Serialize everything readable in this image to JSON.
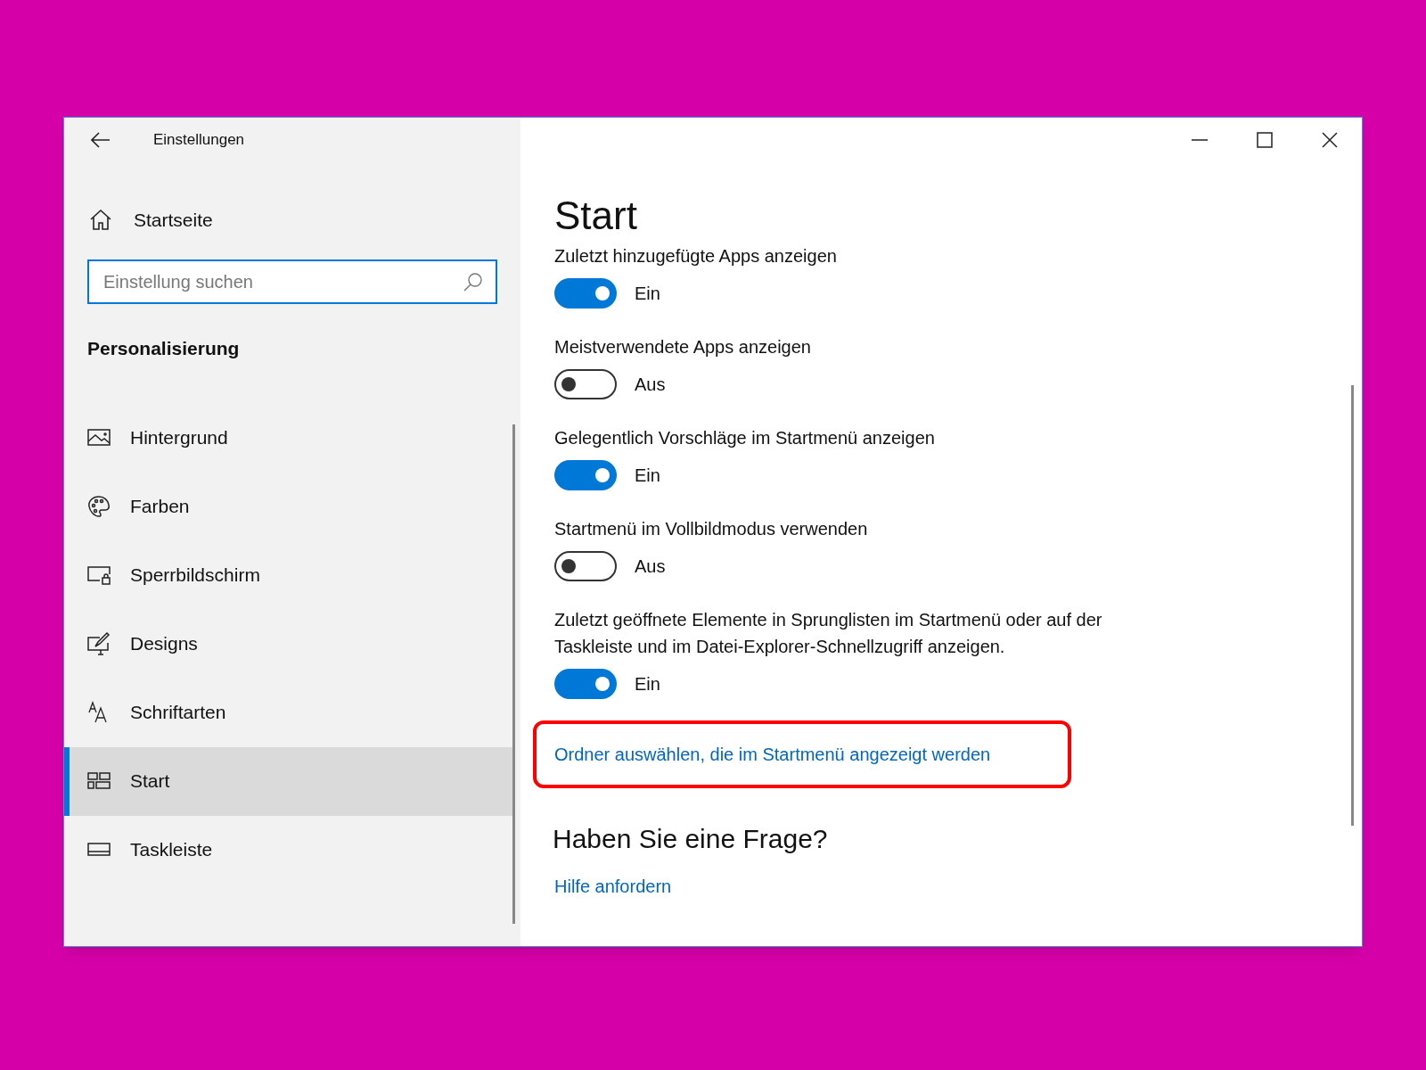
{
  "window": {
    "title": "Einstellungen"
  },
  "sidebar": {
    "home": "Startseite",
    "search": {
      "placeholder": "Einstellung suchen"
    },
    "section": "Personalisierung",
    "items": [
      {
        "kind": "picture",
        "label": "Hintergrund",
        "selected": false
      },
      {
        "kind": "palette",
        "label": "Farben",
        "selected": false
      },
      {
        "kind": "lockscreen",
        "label": "Sperrbildschirm",
        "selected": false
      },
      {
        "kind": "designs",
        "label": "Designs",
        "selected": false
      },
      {
        "kind": "fonts",
        "label": "Schriftarten",
        "selected": false
      },
      {
        "kind": "start",
        "label": "Start",
        "selected": true
      },
      {
        "kind": "taskbar",
        "label": "Taskleiste",
        "selected": false
      }
    ]
  },
  "page": {
    "title": "Start",
    "settings": [
      {
        "label": "Zuletzt hinzugefügte Apps anzeigen",
        "on": true,
        "state": "Ein"
      },
      {
        "label": "Meistverwendete Apps anzeigen",
        "on": false,
        "state": "Aus"
      },
      {
        "label": "Gelegentlich Vorschläge im Startmenü anzeigen",
        "on": true,
        "state": "Ein"
      },
      {
        "label": "Startmenü im Vollbildmodus verwenden",
        "on": false,
        "state": "Aus"
      },
      {
        "label": "Zuletzt geöffnete Elemente in Sprunglisten im Startmenü oder auf der Taskleiste und im Datei-Explorer-Schnellzugriff anzeigen.",
        "on": true,
        "state": "Ein"
      }
    ],
    "link": {
      "text": "Ordner auswählen, die im Startmenü angezeigt werden",
      "highlighted": true
    },
    "question": {
      "title": "Haben Sie eine Frage?",
      "link": "Hilfe anfordern"
    }
  }
}
